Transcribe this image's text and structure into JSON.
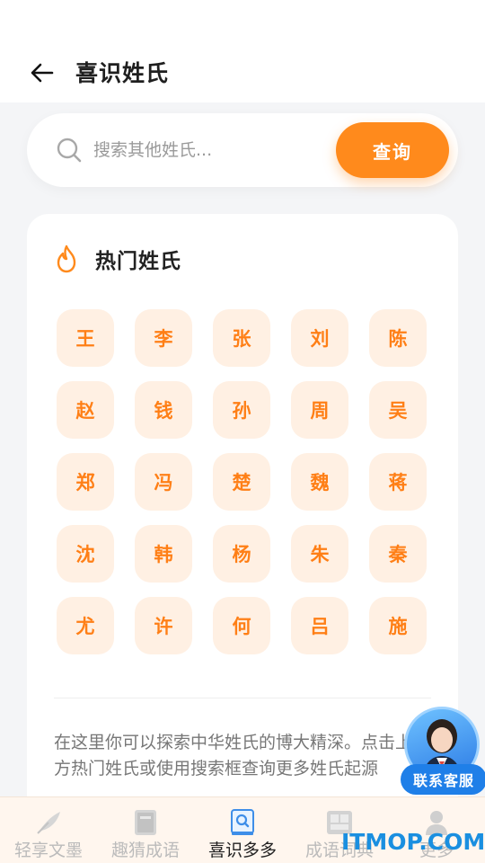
{
  "header": {
    "title": "喜识姓氏"
  },
  "search": {
    "placeholder": "搜索其他姓氏...",
    "button_label": "查询"
  },
  "hot_surnames": {
    "title": "热门姓氏",
    "items": [
      "王",
      "李",
      "张",
      "刘",
      "陈",
      "赵",
      "钱",
      "孙",
      "周",
      "吴",
      "郑",
      "冯",
      "楚",
      "魏",
      "蒋",
      "沈",
      "韩",
      "杨",
      "朱",
      "秦",
      "尤",
      "许",
      "何",
      "吕",
      "施"
    ]
  },
  "description": "在这里你可以探索中华姓氏的博大精深。点击上方热门姓氏或使用搜索框查询更多姓氏起源",
  "customer_service": {
    "label": "联系客服"
  },
  "tabs": [
    {
      "label": "轻享文墨",
      "icon": "feather-icon",
      "active": false
    },
    {
      "label": "趣猜成语",
      "icon": "book-icon",
      "active": false
    },
    {
      "label": "喜识多多",
      "icon": "search-book-icon",
      "active": true
    },
    {
      "label": "成语词典",
      "icon": "dictionary-icon",
      "active": false
    },
    {
      "label": "更多",
      "icon": "user-icon",
      "active": false
    }
  ],
  "watermark": "ITMOP.COM",
  "colors": {
    "accent": "#ff8a1c",
    "surname_bg": "#fff0e3",
    "surname_text": "#ff7f16",
    "service_blue": "#1f7fe8"
  }
}
